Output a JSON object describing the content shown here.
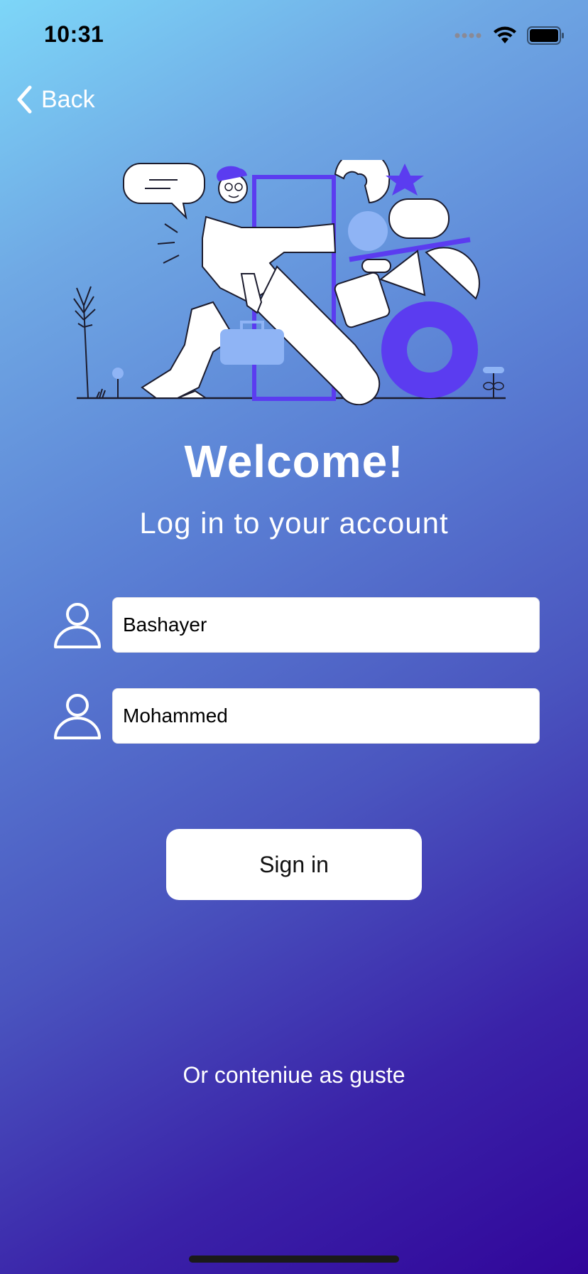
{
  "status_bar": {
    "time": "10:31",
    "signal_icon": "cellular-dots-icon",
    "wifi_icon": "wifi-icon",
    "battery_icon": "battery-icon"
  },
  "nav": {
    "back_label": "Back",
    "back_icon": "chevron-left-icon"
  },
  "illustration": {
    "description_icon": "person-carrying-shapes-illustration"
  },
  "heading": {
    "title": "Welcome!",
    "subtitle": "Log in to your account"
  },
  "form": {
    "first_name": {
      "icon": "person-icon",
      "value": "Bashayer"
    },
    "last_name": {
      "icon": "person-icon",
      "value": "Mohammed"
    },
    "sign_in_label": "Sign in"
  },
  "guest_link": "Or conteniue as guste",
  "colors": {
    "gradient_start": "#7dd6f8",
    "gradient_end": "#31069a",
    "accent_purple": "#5b3cf0",
    "accent_light_blue": "#8fb4f5"
  }
}
